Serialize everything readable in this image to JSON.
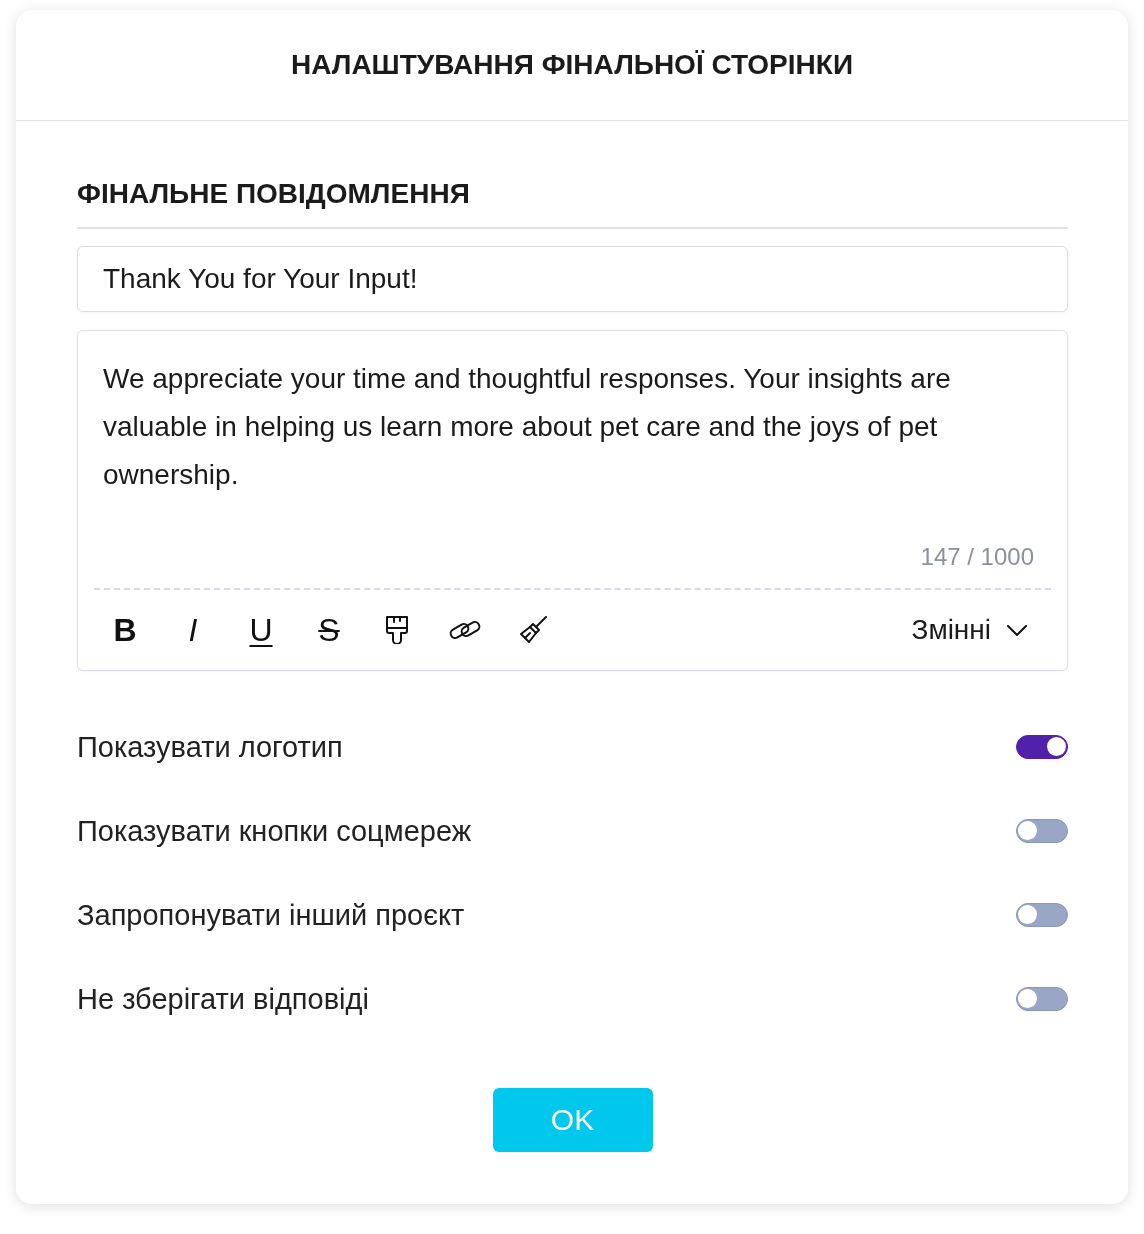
{
  "dialog": {
    "title": "НАЛАШТУВАННЯ ФІНАЛЬНОЇ СТОРІНКИ"
  },
  "message_section": {
    "heading": "ФІНАЛЬНЕ ПОВІДОМЛЕННЯ",
    "title_field": {
      "value": "Thank You for Your Input!"
    },
    "body_field": {
      "value": "We appreciate your time and thoughtful responses. Your insights are valuable in helping us learn more about pet care and the joys of pet ownership.",
      "counter": "147 / 1000"
    },
    "toolbar": {
      "tools": [
        {
          "kind": "bold",
          "label": "B"
        },
        {
          "kind": "italic",
          "label": "I"
        },
        {
          "kind": "underline",
          "label": "U"
        },
        {
          "kind": "strikethrough",
          "label": "S"
        },
        {
          "kind": "format-painter"
        },
        {
          "kind": "link"
        },
        {
          "kind": "clear-formatting"
        }
      ],
      "variables_menu": {
        "label": "Змінні"
      }
    }
  },
  "options": [
    {
      "label": "Показувати логотип",
      "on": true
    },
    {
      "label": "Показувати кнопки соцмереж",
      "on": false
    },
    {
      "label": "Запропонувати інший проєкт",
      "on": false
    },
    {
      "label": "Не зберігати відповіді",
      "on": false
    }
  ],
  "footer": {
    "confirm_button": "OK"
  }
}
